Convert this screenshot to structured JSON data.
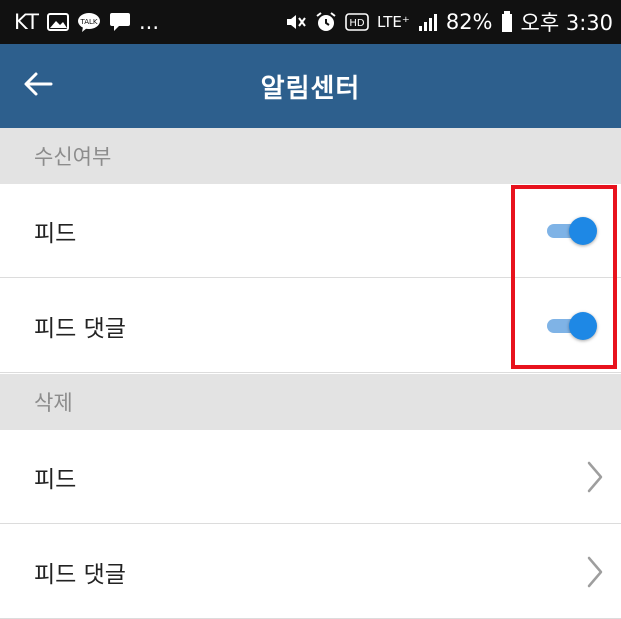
{
  "status_bar": {
    "carrier": "KT",
    "left_icons": [
      "gallery-icon",
      "kakaotalk-icon",
      "message-icon"
    ],
    "ellipsis": "...",
    "right_icons": [
      "mute-icon",
      "alarm-icon",
      "hd-icon",
      "lte-icon",
      "signal-icon"
    ],
    "lte_label": "LTE⁺",
    "battery_percent": "82%",
    "time": "오후 3:30"
  },
  "app_bar": {
    "title": "알림센터",
    "back_icon": "back-arrow-icon",
    "background_color": "#2d5f8d"
  },
  "sections": [
    {
      "header": "수신여부",
      "items": [
        {
          "label": "피드",
          "control": "toggle",
          "on": true
        },
        {
          "label": "피드 댓글",
          "control": "toggle",
          "on": true
        }
      ]
    },
    {
      "header": "삭제",
      "items": [
        {
          "label": "피드",
          "control": "chevron-right-icon"
        },
        {
          "label": "피드 댓글",
          "control": "chevron-right-icon"
        }
      ]
    }
  ],
  "colors": {
    "toggle_on": "#1e88e5",
    "highlight": "#e8121d",
    "section_header_bg": "#e3e3e3"
  }
}
